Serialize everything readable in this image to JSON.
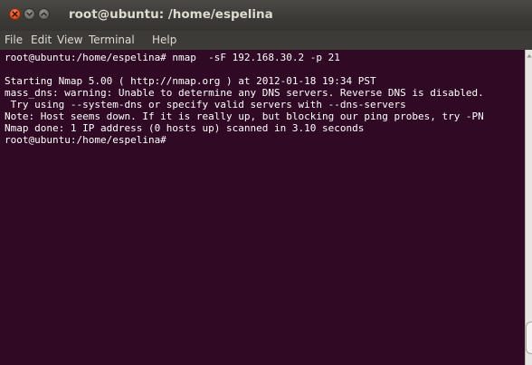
{
  "window": {
    "title": "root@ubuntu: /home/espelina",
    "controls": [
      "close-icon",
      "minimize-icon",
      "maximize-icon"
    ]
  },
  "menubar": {
    "items": [
      "File",
      "Edit",
      "View",
      "Terminal",
      "Help"
    ]
  },
  "terminal": {
    "background": "#300a24",
    "foreground": "#ffffff",
    "lines": [
      "root@ubuntu:/home/espelina# nmap  -sF 192.168.30.2 -p 21",
      "",
      "Starting Nmap 5.00 ( http://nmap.org ) at 2012-01-18 19:34 PST",
      "mass_dns: warning: Unable to determine any DNS servers. Reverse DNS is disabled.",
      " Try using --system-dns or specify valid servers with --dns-servers",
      "Note: Host seems down. If it is really up, but blocking our ping probes, try -PN",
      "Nmap done: 1 IP address (0 hosts up) scanned in 3.10 seconds",
      "root@ubuntu:/home/espelina#"
    ]
  },
  "colors": {
    "titlebar": "#3c3b37",
    "close_button": "#e2511d",
    "title_text": "#dfdbd2"
  }
}
